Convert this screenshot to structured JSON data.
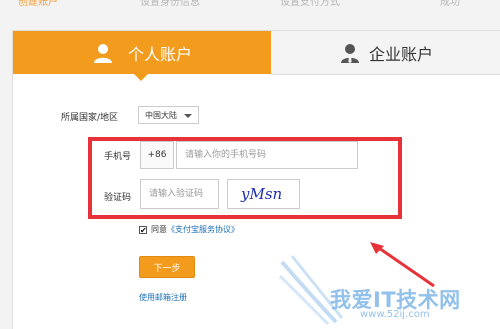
{
  "steps": [
    "创建账户",
    "设置身份信息",
    "设置支付方式",
    "成功"
  ],
  "tabs": {
    "personal": "个人账户",
    "business": "企业账户"
  },
  "form": {
    "region_label": "所属国家/地区",
    "region_value": "中国大陆",
    "phone_label": "手机号",
    "phone_prefix": "+86",
    "phone_placeholder": "请输入你的手机号码",
    "code_label": "验证码",
    "code_placeholder": "请输入验证码",
    "captcha_text": "yMsn",
    "agree_prefix": "同意",
    "agree_link": "《支付宝服务协议》",
    "next_button": "下一步",
    "email_register": "使用邮箱注册"
  },
  "watermark": {
    "text": "我爱IT技术网",
    "url": "www.52ij.com"
  },
  "colors": {
    "accent": "#f29b1d",
    "highlight": "#e8323a",
    "link": "#1a6fb5"
  }
}
